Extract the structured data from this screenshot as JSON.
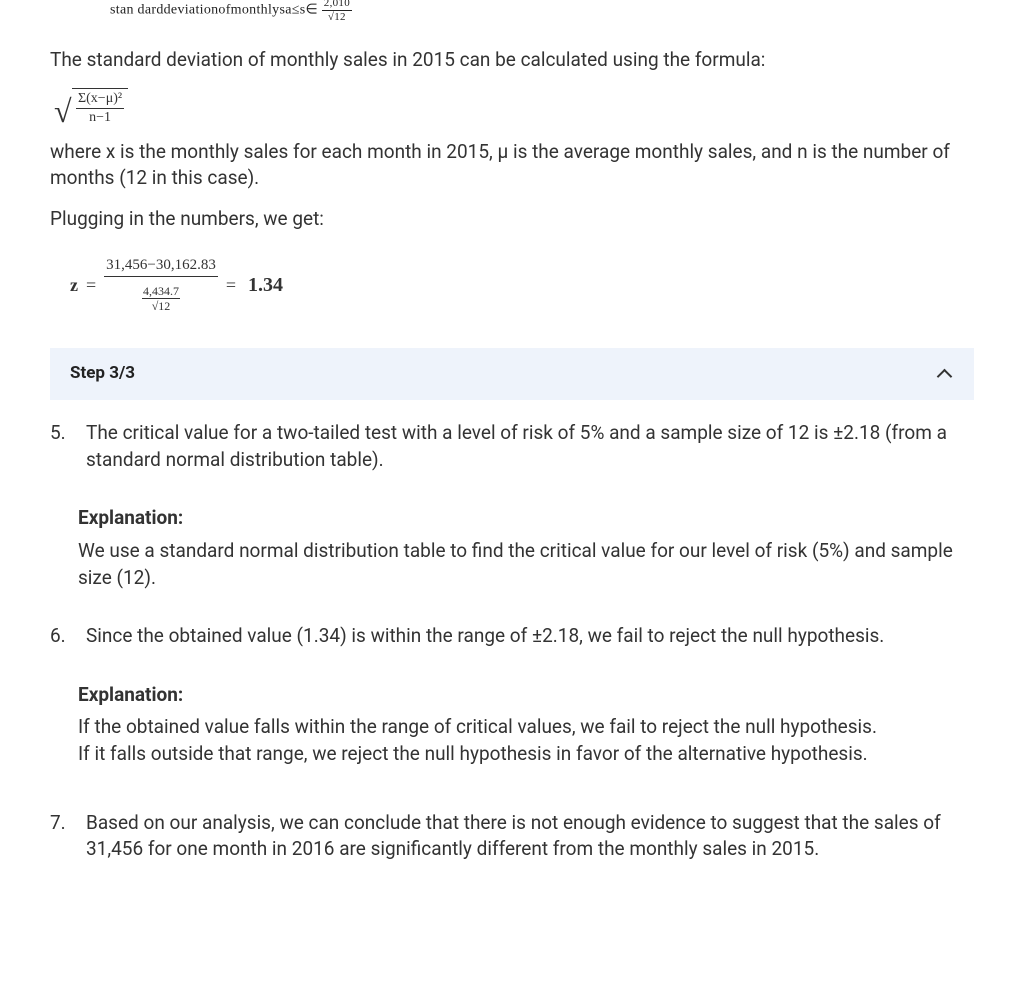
{
  "top_fragment": {
    "prefix": "stan darddeviationofmonthlysa≤s∈",
    "num": "2,010",
    "den": "√12"
  },
  "intro_para": "The standard deviation of monthly sales in 2015 can be calculated using the formula:",
  "sd_formula": {
    "num": "Σ(x−μ)²",
    "den": "n−1"
  },
  "where_para_1": "where x is the monthly sales for each month in 2015, μ is the average monthly sales, and n is the number of months (12 in this case).",
  "where_para_2": "Plugging in the numbers, we get:",
  "z_formula": {
    "lhs": "z",
    "eq1": "=",
    "top": "31,456−30,162.83",
    "den_num": "4,434.7",
    "den_den": "√12",
    "eq2": "=",
    "result": "1.34"
  },
  "step_header": "Step 3/3",
  "item5": {
    "num": "5.",
    "text": "The critical value for a two-tailed test with a level of risk of 5% and a sample size of 12 is ±2.18 (from a standard normal distribution table)."
  },
  "item5_expl": {
    "label": "Explanation:",
    "text": "We use a standard normal distribution table to find the critical value for our level of risk (5%) and sample size (12)."
  },
  "item6": {
    "num": "6.",
    "text": "Since the obtained value (1.34) is within the range of ±2.18, we fail to reject the null hypothesis."
  },
  "item6_expl": {
    "label": "Explanation:",
    "text_line1": "If the obtained value falls within the range of critical values, we fail to reject the null hypothesis.",
    "text_line2": "If it falls outside that range, we reject the null hypothesis in favor of the alternative hypothesis."
  },
  "item7": {
    "num": "7.",
    "text": "Based on our analysis, we can conclude that there is not enough evidence to suggest that the sales of 31,456 for one month in 2016 are significantly different from the monthly sales in 2015."
  }
}
